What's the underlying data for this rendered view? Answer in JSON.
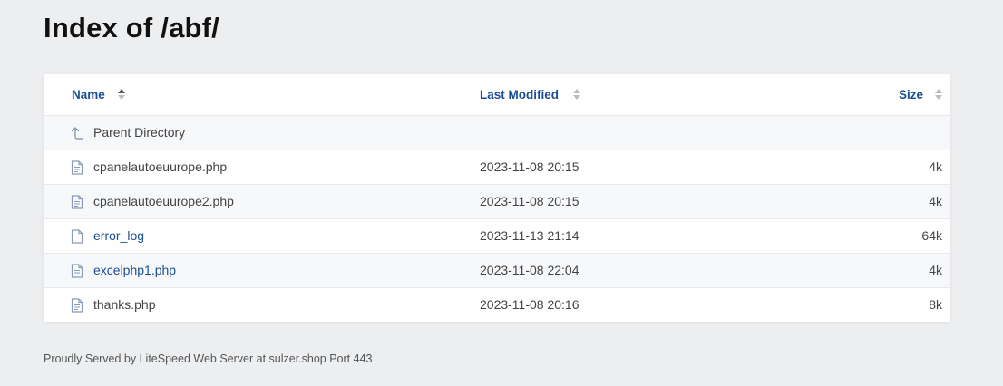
{
  "page": {
    "title": "Index of /abf/",
    "footer": "Proudly Served by LiteSpeed Web Server at sulzer.shop Port 443"
  },
  "columns": {
    "name": "Name",
    "modified": "Last Modified",
    "size": "Size"
  },
  "parent": {
    "label": "Parent Directory",
    "icon": "arrow-up-icon"
  },
  "files": [
    {
      "name": "cpanelautoeuurope.php",
      "modified": "2023-11-08 20:15",
      "size": "4k",
      "icon": "file-text-icon",
      "link_color": "#444444"
    },
    {
      "name": "cpanelautoeuurope2.php",
      "modified": "2023-11-08 20:15",
      "size": "4k",
      "icon": "file-text-icon",
      "link_color": "#444444"
    },
    {
      "name": "error_log",
      "modified": "2023-11-13 21:14",
      "size": "64k",
      "icon": "file-icon",
      "link_color": "#1a4f95"
    },
    {
      "name": "excelphp1.php",
      "modified": "2023-11-08 22:04",
      "size": "4k",
      "icon": "file-text-icon",
      "link_color": "#1a4f95"
    },
    {
      "name": "thanks.php",
      "modified": "2023-11-08 20:16",
      "size": "8k",
      "icon": "file-text-icon",
      "link_color": "#444444"
    }
  ],
  "colors": {
    "background": "#edeef0",
    "accent": "#1a4f95",
    "icon": "#8a9bb8"
  }
}
